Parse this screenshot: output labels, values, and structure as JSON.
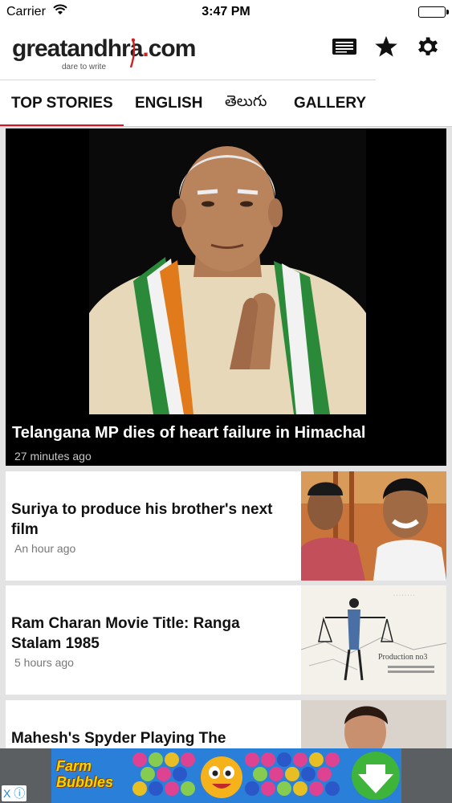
{
  "status_bar": {
    "carrier": "Carrier",
    "time": "3:47 PM"
  },
  "header": {
    "logo_text": "greatandhra",
    "logo_suffix": "com",
    "logo_tagline": "dare to write",
    "icons": [
      "newspaper-icon",
      "star-icon",
      "gear-icon"
    ]
  },
  "tabs": [
    {
      "label": "TOP STORIES",
      "active": true
    },
    {
      "label": "ENGLISH",
      "active": false
    },
    {
      "label": "తెలుగు",
      "active": false
    },
    {
      "label": "GALLERY",
      "active": false
    }
  ],
  "feed": {
    "hero": {
      "title": "Telangana MP dies of heart failure in Himachal",
      "time": "27 minutes ago"
    },
    "items": [
      {
        "title": "Suriya to produce his brother's next film",
        "time": "An hour ago"
      },
      {
        "title": "Ram Charan Movie Title: Ranga Stalam 1985",
        "time": "5 hours ago",
        "thumb_caption": "Production no3"
      },
      {
        "title": "Mahesh's Spyder Playing The",
        "time": ""
      }
    ]
  },
  "ad": {
    "label_line1": "Farm",
    "label_line2": "Bubbles",
    "close_label": "X"
  },
  "colors": {
    "accent": "#d9141f",
    "hero_bg": "#000000",
    "feed_bg": "#e3e3e3"
  }
}
